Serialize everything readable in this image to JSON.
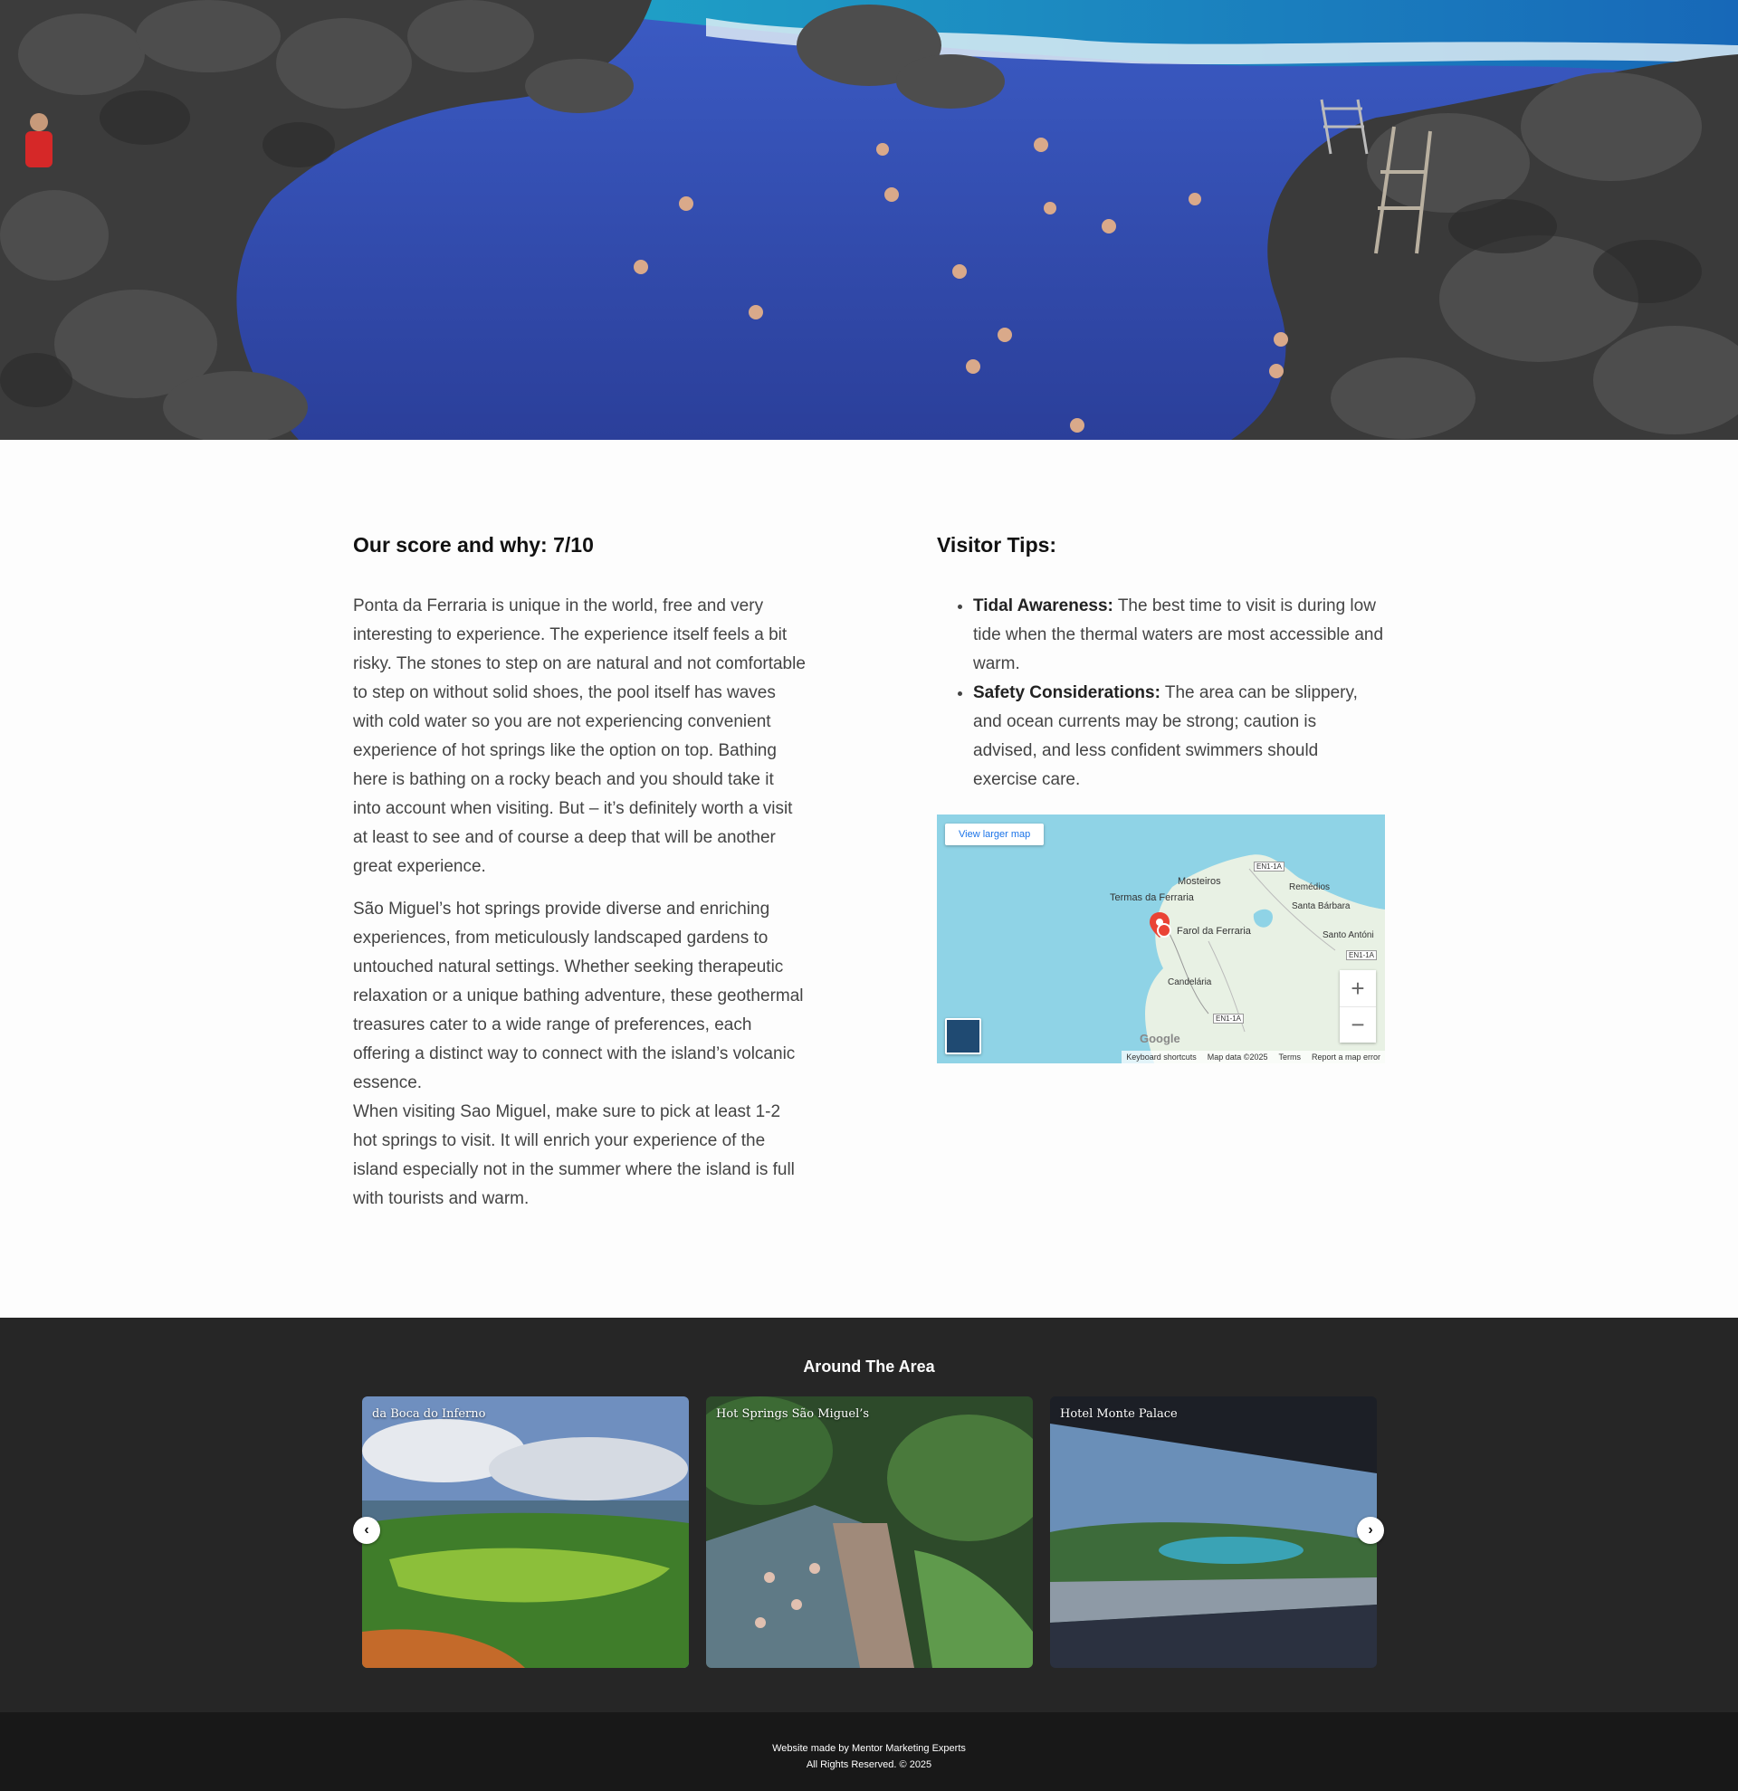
{
  "score": {
    "title": "Our score and why: 7/10",
    "paragraphs": [
      "Ponta da Ferraria is unique in the world, free and very interesting to experience. The experience itself feels a bit risky. The stones to step on are natural and not comfortable to step on without solid shoes, the pool itself has waves with cold water so you are not experiencing convenient experience of hot springs like the option on top. Bathing here is bathing on a rocky beach and you should take it into account when visiting. But – it’s definitely worth a visit at least to see and of course a deep that will be another great experience.",
      "São Miguel’s hot springs provide diverse and enriching experiences, from meticulously landscaped gardens to untouched natural settings. Whether seeking therapeutic relaxation or a unique bathing adventure, these geothermal treasures cater to a wide range of preferences, each offering a distinct way to connect with the island’s volcanic essence.",
      "When visiting Sao Miguel, make sure to pick at least 1-2 hot springs to visit. It will enrich your experience of the island especially not in the summer where the island is full with tourists and warm."
    ]
  },
  "tips": {
    "title": "Visitor Tips:",
    "items": [
      {
        "label": "Tidal Awareness:",
        "text": " The best time to visit is during low tide when the thermal waters are most accessible and warm."
      },
      {
        "label": "Safety Considerations:",
        "text": " The area can be slippery, and ocean currents may be strong; caution is advised, and less confident swimmers should exercise care."
      }
    ]
  },
  "map": {
    "view_larger": "View larger map",
    "zoom_in": "+",
    "zoom_out": "−",
    "places": {
      "mosteiros": "Mosteiros",
      "termas": "Termas da Ferraria",
      "farol": "Farol da Ferraria",
      "remedios": "Remédios",
      "santa_barbara": "Santa Bárbara",
      "santo_antonio": "Santo Antóni",
      "candelaria": "Candelária"
    },
    "road_labels": [
      "EN1-1A",
      "EN1-1A",
      "EN1-1A"
    ],
    "google": "Google",
    "attribution": [
      "Keyboard shortcuts",
      "Map data ©2025",
      "Terms",
      "Report a map error"
    ]
  },
  "around": {
    "title": "Around The Area",
    "cards": [
      {
        "label": "da Boca do Inferno"
      },
      {
        "label": "Hot Springs São Miguel’s"
      },
      {
        "label": "Hotel Monte Palace"
      }
    ],
    "prev_arrow": "‹",
    "next_arrow": "›"
  },
  "footer": {
    "line1": "Website made by Mentor Marketing Experts",
    "line2": "All Rights Reserved. © 2025"
  }
}
